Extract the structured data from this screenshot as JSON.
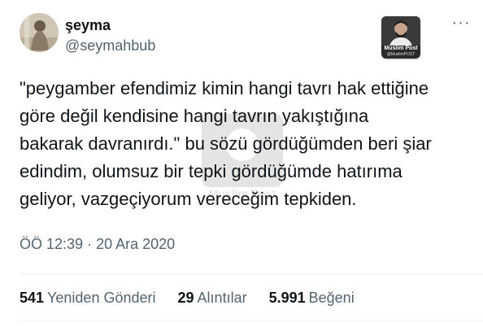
{
  "author": {
    "display_name": "şeyma",
    "handle": "@seymahbub"
  },
  "badge": {
    "title": "Muslim Post",
    "subtitle": "@MuslimPOST"
  },
  "watermark": {
    "text": "Muslim Post"
  },
  "tweet": {
    "text": "\"peygamber efendimiz kimin hangi tavrı hak ettiğine\ngöre değil kendisine hangi tavrın yakıştığına\nbakarak davranırdı.\" bu sözü gördüğümden beri şiar\nedindim, olumsuz bir tepki gördüğümde hatırıma\ngeliyor, vazgeçiyorum vereceğim tepkiden.",
    "time": "ÖÖ 12:39",
    "separator": "·",
    "date": "20 Ara 2020"
  },
  "stats": {
    "retweets_count": "541",
    "retweets_label": "Yeniden Gönderi",
    "quotes_count": "29",
    "quotes_label": "Alıntılar",
    "likes_count": "5.991",
    "likes_label": "Beğeni"
  },
  "icons": {
    "more": "more-dots-icon"
  }
}
